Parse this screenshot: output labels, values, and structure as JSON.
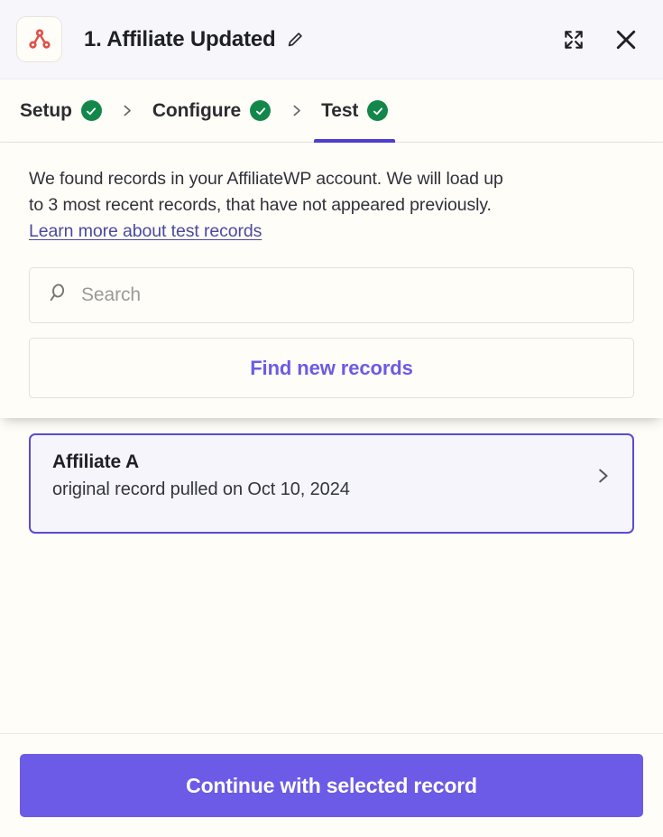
{
  "header": {
    "app_icon_name": "affiliatewp-network-icon",
    "title": "1. Affiliate Updated",
    "edit_icon": "pencil-icon",
    "expand_icon": "expand-fullscreen-icon",
    "close_icon": "close-icon",
    "background": "#F7F6FB",
    "icon_color": "#E0514B"
  },
  "tabs": {
    "separator_icon": "chevron-right-icon",
    "active_color": "#4F3FD0",
    "check_color": "#13874A",
    "items": [
      {
        "label": "Setup",
        "status": "complete",
        "active": false
      },
      {
        "label": "Configure",
        "status": "complete",
        "active": false
      },
      {
        "label": "Test",
        "status": "complete",
        "active": true
      }
    ]
  },
  "main": {
    "intro_line1": "We found records in your AffiliateWP account. We will load up",
    "intro_line2": "to 3 most recent records, that have not appeared previously.",
    "intro_link": "Learn more about test records",
    "link_color": "#4A4A9E",
    "search": {
      "icon": "search-icon",
      "placeholder": "Search",
      "value": ""
    },
    "find_records_label": "Find new records",
    "find_records_color": "#6B5BE6"
  },
  "records": {
    "selected_border_color": "#5B4BD4",
    "selected_background": "#F6F5FC",
    "items": [
      {
        "title": "Affiliate A",
        "subtitle": "original record pulled on Oct 10, 2024",
        "chevron_icon": "chevron-right-icon",
        "selected": true
      }
    ]
  },
  "footer": {
    "continue_label": "Continue with selected record",
    "continue_color": "#6B5BE6"
  }
}
